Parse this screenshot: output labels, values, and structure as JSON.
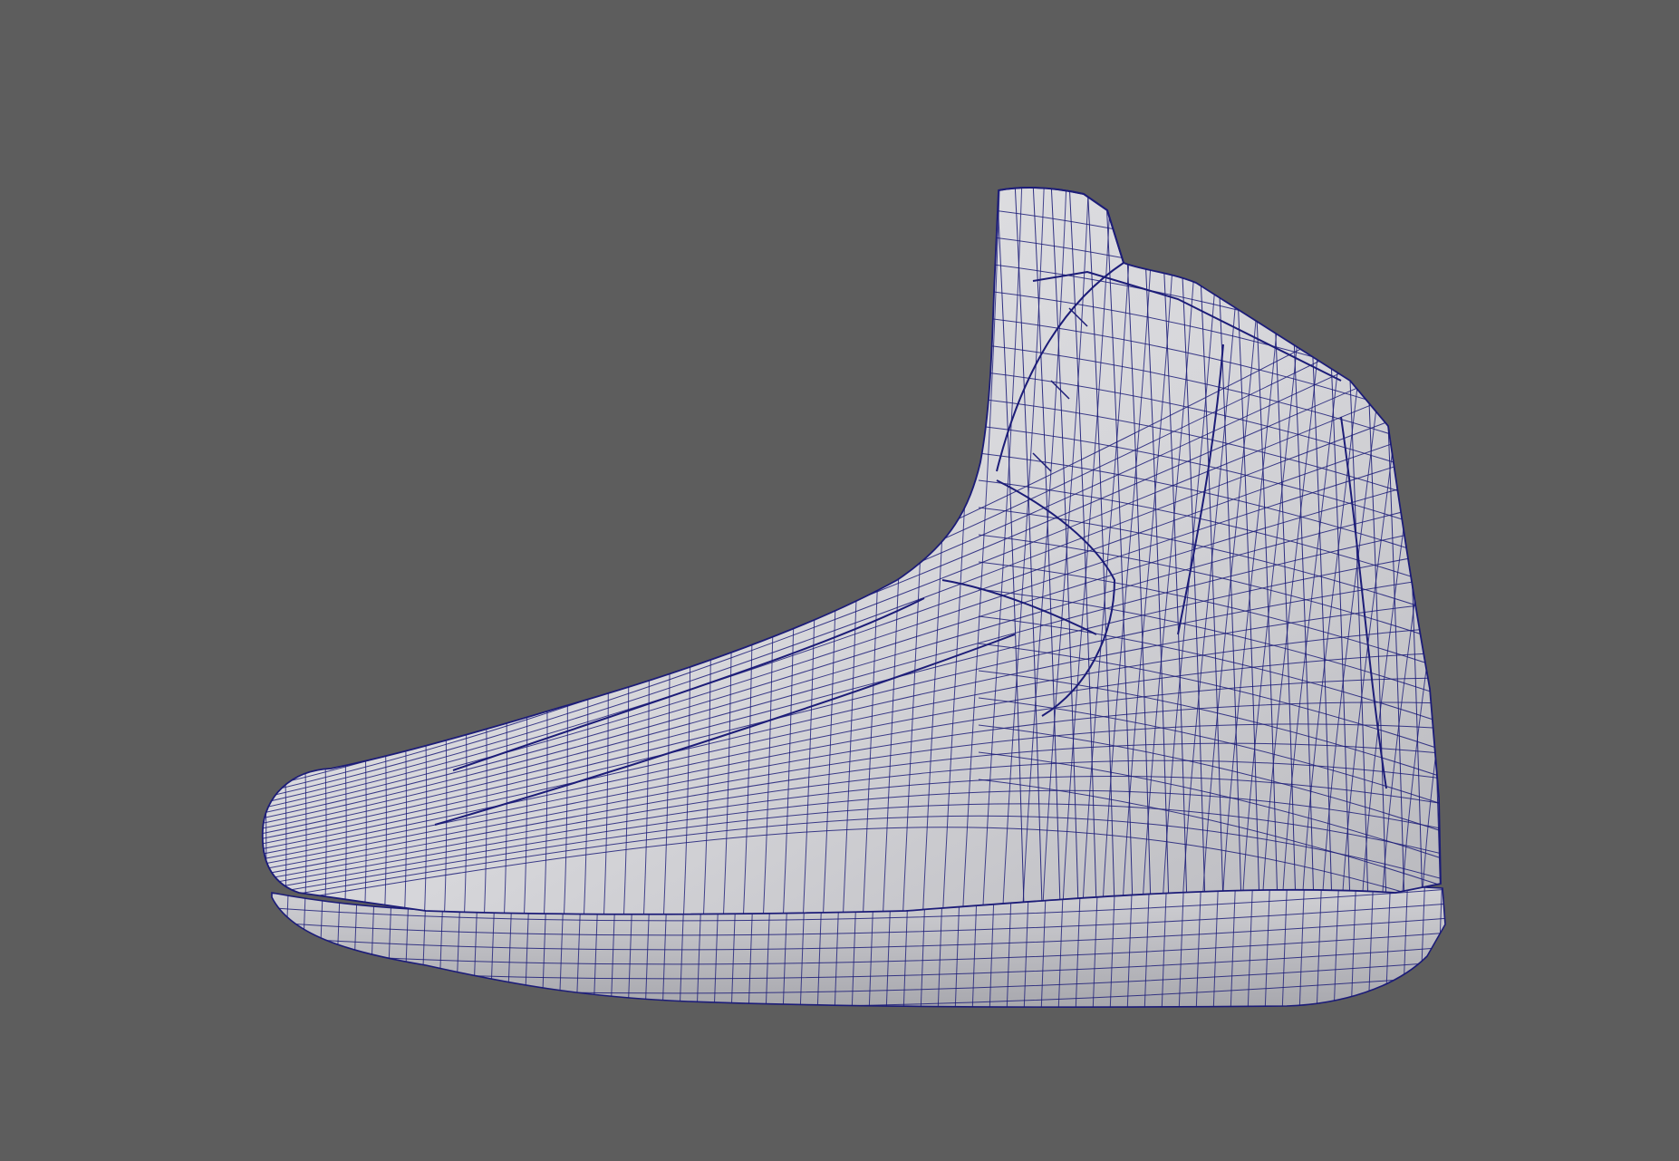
{
  "viewport": {
    "background_color": "#5d5d5d",
    "display_mode": "wireframe-on-shaded",
    "object": "shoe-mesh"
  },
  "mesh": {
    "shade_color": "#d9d9dc",
    "shadow_color": "#a9a9ae",
    "wire_color": "#1c1c78",
    "sole_color": "#c9c9cd"
  }
}
